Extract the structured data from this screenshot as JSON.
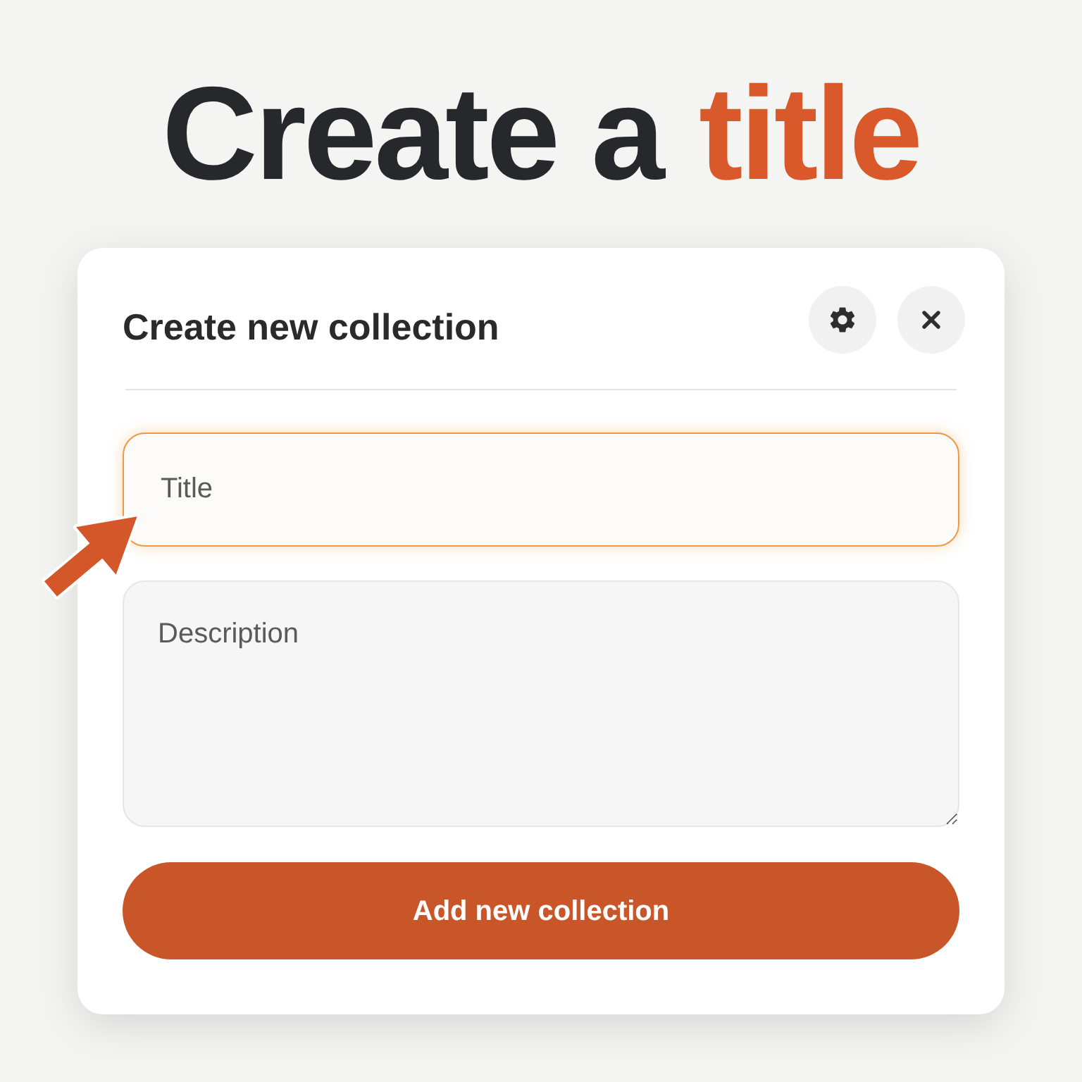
{
  "headline": [
    {
      "text": "Create a",
      "accent": false
    },
    {
      "text": "title",
      "accent": true
    }
  ],
  "dialog": {
    "title": "Create new collection",
    "header_buttons": [
      {
        "kind": "settings"
      },
      {
        "kind": "close"
      }
    ],
    "fields": [
      {
        "kind": "input",
        "placeholder": "Title",
        "focused": true
      },
      {
        "kind": "textarea",
        "placeholder": "Description",
        "focused": false
      }
    ],
    "submit": "Add new collection"
  }
}
